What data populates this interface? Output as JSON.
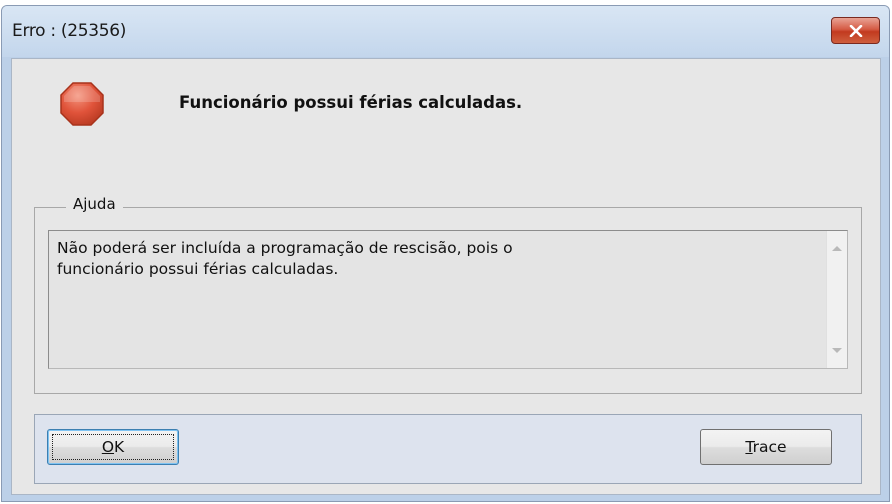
{
  "window": {
    "title": "Erro : (25356)",
    "close_icon": "close-icon"
  },
  "dialog": {
    "icon": "stop-icon",
    "message": "Funcionário possui férias calculadas."
  },
  "help": {
    "group_label": "Ajuda",
    "text": "Não poderá ser incluída a programação de rescisão, pois o\nfuncionário possui férias calculadas."
  },
  "buttons": {
    "ok_label": "OK",
    "trace_label": "Trace"
  },
  "colors": {
    "close_button": "#c9472c",
    "stop_icon": "#e0533a",
    "dialog_background": "#e7e7e7",
    "title_bar": "#c3d6ec"
  }
}
